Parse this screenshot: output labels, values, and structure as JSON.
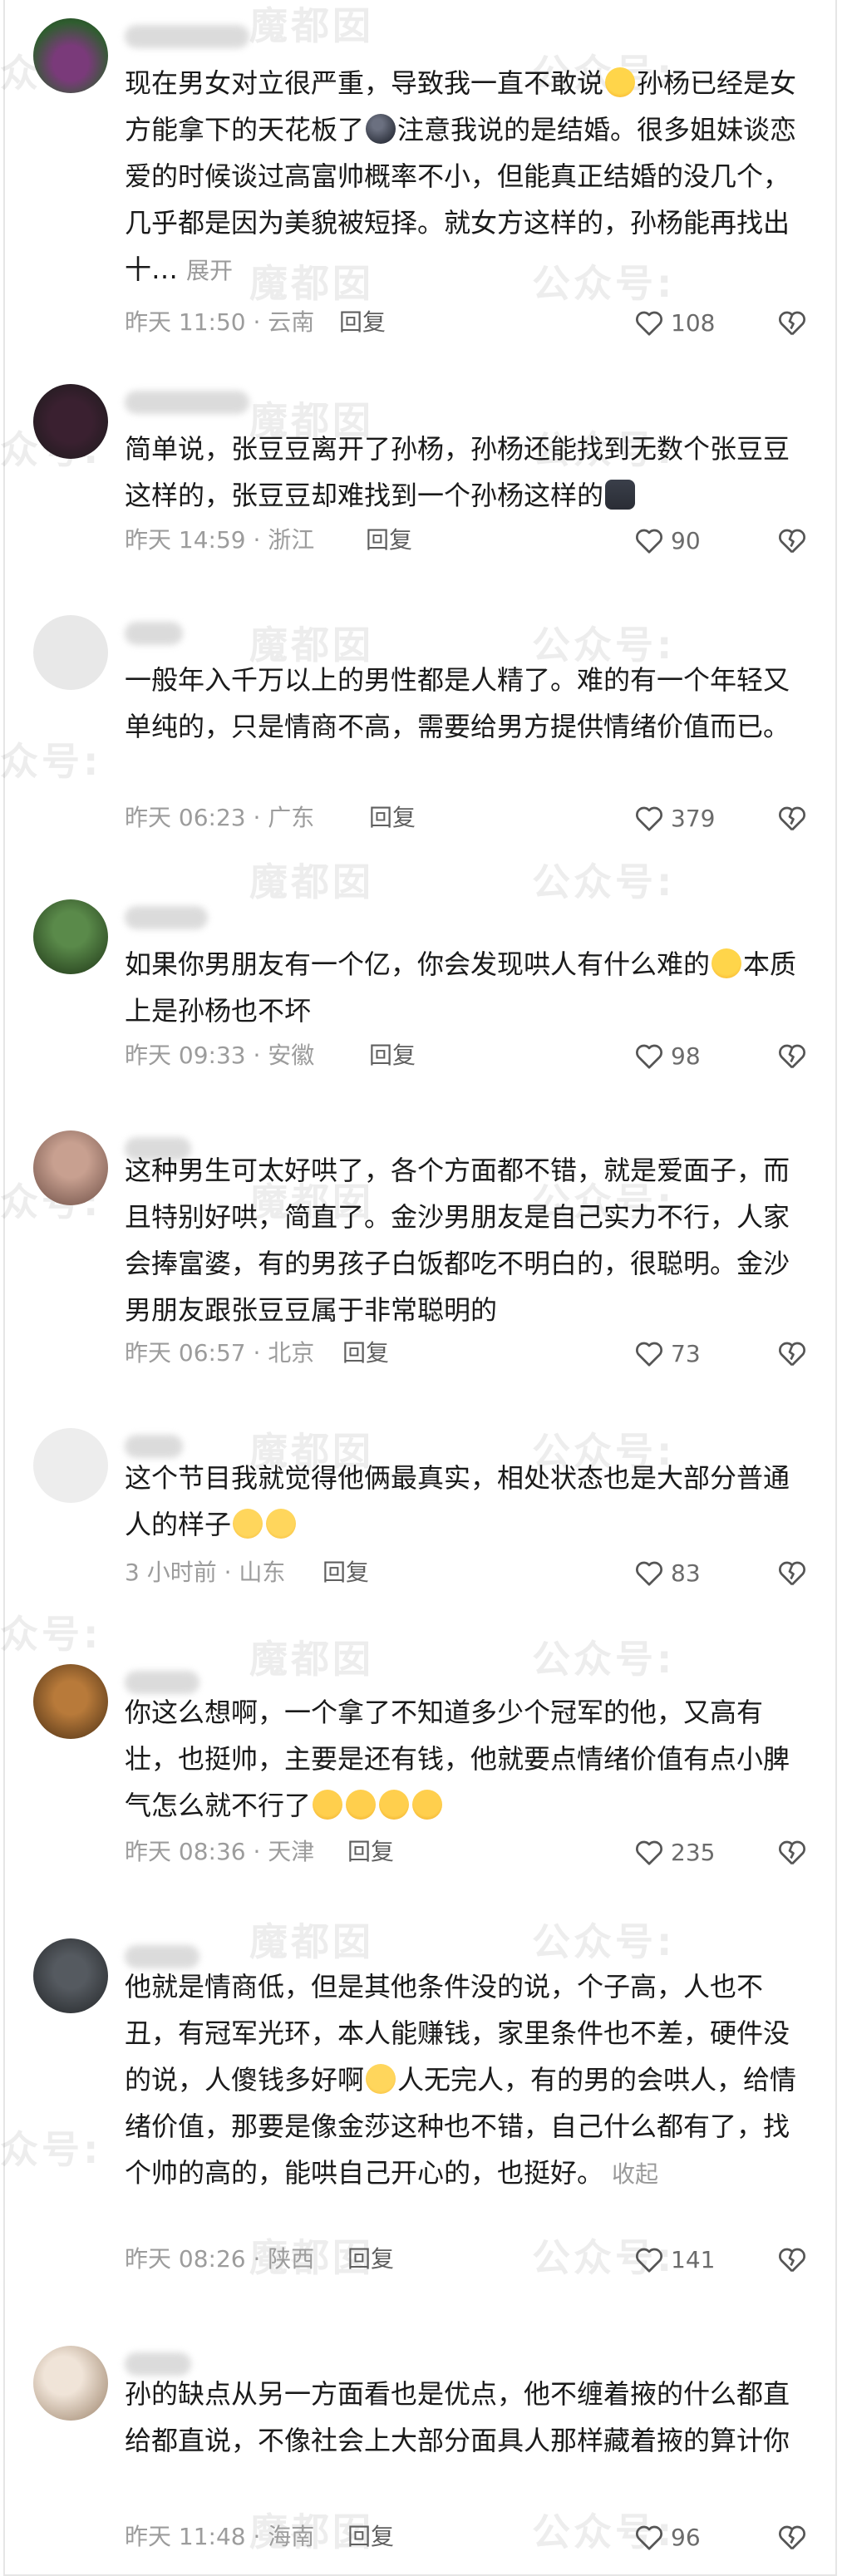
{
  "watermarks": {
    "left": "众号:",
    "brand": "魔都囡",
    "account": "公众号:"
  },
  "comments": [
    {
      "text_parts": [
        "现在男女对立很严重，导致我一直不敢说",
        "孙杨已经是女方能拿下的天花板了",
        "注意我说的是结婚。很多姐妹谈恋爱的时候谈过高富帅概率不小，但能真正结婚的没几个，几乎都是因为美貌被短择。就女方这样的，孙杨能再找出十…"
      ],
      "more": "展开",
      "time": "昨天 11:50 · 云南",
      "reply": "回复",
      "likes": "108"
    },
    {
      "text_parts": [
        "简单说，张豆豆离开了孙杨，孙杨还能找到无数个张豆豆这样的，张豆豆却难找到一个孙杨这样的"
      ],
      "time": "昨天 14:59 · 浙江",
      "reply": "回复",
      "likes": "90"
    },
    {
      "text_parts": [
        "一般年入千万以上的男性都是人精了。难的有一个年轻又单纯的，只是情商不高，需要给男方提供情绪价值而已。"
      ],
      "time": "昨天 06:23 · 广东",
      "reply": "回复",
      "likes": "379"
    },
    {
      "text_parts": [
        "如果你男朋友有一个亿，你会发现哄人有什么难的",
        "本质上是孙杨也不坏"
      ],
      "time": "昨天 09:33 · 安徽",
      "reply": "回复",
      "likes": "98"
    },
    {
      "text_parts": [
        "这种男生可太好哄了，各个方面都不错，就是爱面子，而且特别好哄，简直了。金沙男朋友是自己实力不行，人家会捧富婆，有的男孩子白饭都吃不明白的，很聪明。金沙男朋友跟张豆豆属于非常聪明的"
      ],
      "time": "昨天 06:57 · 北京",
      "reply": "回复",
      "likes": "73"
    },
    {
      "text_parts": [
        "这个节目我就觉得他俩最真实，相处状态也是大部分普通人的样子"
      ],
      "time": "3 小时前 · 山东",
      "reply": "回复",
      "likes": "83"
    },
    {
      "text_parts": [
        "你这么想啊，一个拿了不知道多少个冠军的他，又高有壮，也挺帅，主要是还有钱，他就要点情绪价值有点小脾气怎么就不行了"
      ],
      "time": "昨天 08:36 · 天津",
      "reply": "回复",
      "likes": "235"
    },
    {
      "text_parts": [
        "他就是情商低，但是其他条件没的说，个子高，人也不丑，有冠军光环，本人能赚钱，家里条件也不差，硬件没的说，人傻钱多好啊",
        "人无完人，有的男的会哄人，给情绪价值，那要是像金莎这种也不错，自己什么都有了，找个帅的高的，能哄自己开心的，也挺好。"
      ],
      "more": "收起",
      "time": "昨天 08:26 · 陕西",
      "reply": "回复",
      "likes": "141"
    },
    {
      "text_parts": [
        "孙的缺点从另一方面看也是优点，他不缠着掖的什么都直给都直说，不像社会上大部分面具人那样藏着掖的算计你"
      ],
      "time": "昨天 11:48 · 海南",
      "reply": "回复",
      "likes": "96"
    }
  ]
}
